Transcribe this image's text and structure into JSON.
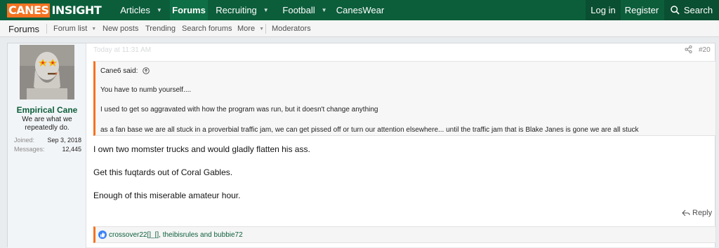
{
  "logo": {
    "part1": "CANES",
    "part2": "INSIGHT"
  },
  "nav": {
    "items": [
      {
        "label": "Articles",
        "has_menu": true
      },
      {
        "label": "Forums",
        "has_menu": false,
        "selected": true
      },
      {
        "label": "Recruiting",
        "has_menu": true
      },
      {
        "label": "Football",
        "has_menu": true
      },
      {
        "label": "CanesWear",
        "has_menu": false
      }
    ],
    "login": "Log in",
    "register": "Register",
    "search": "Search"
  },
  "subnav": {
    "title": "Forums",
    "items": [
      "Forum list",
      "New posts",
      "Trending",
      "Search forums",
      "More",
      "Moderators"
    ]
  },
  "post": {
    "date": "Today at 11:31 AM",
    "post_number": "#20",
    "user": {
      "name": "Empirical Cane",
      "title": "We are what we repeatedly do.",
      "joined_label": "Joined:",
      "joined_value": "Sep 3, 2018",
      "messages_label": "Messages:",
      "messages_value": "12,445"
    },
    "quote": {
      "author": "Cane6 said:",
      "lines": [
        "You have to numb yourself....",
        "I used to get so aggravated with how the program was run, but it doesn't change anything",
        "as a fan base we are all stuck in a proverbial traffic jam, we can get pissed off or turn our attention elsewhere... until the traffic jam that is Blake Janes is gone we are all stuck"
      ]
    },
    "message": [
      "I own two momster trucks and would gladly flatten his ass.",
      "Get this fuqtards out of Coral Gables.",
      "Enough of this miserable amateur hour."
    ],
    "reply_label": "Reply",
    "reactions": "crossover22[]_[], theibisrules and bubbie72"
  },
  "colors": {
    "brand_green": "#0c5e3b",
    "brand_orange": "#f47321"
  }
}
